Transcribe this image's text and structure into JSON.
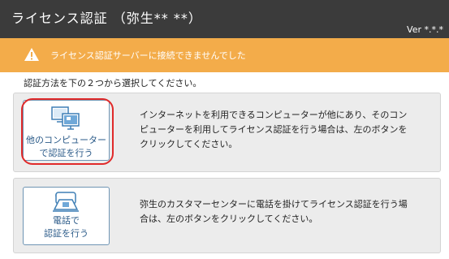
{
  "titlebar": {
    "title": "ライセンス認証 （弥生** **）",
    "version": "Ver *.*.*"
  },
  "warning": {
    "icon": "warning-icon",
    "text": "ライセンス認証サーバーに接続できませんでした",
    "color": "#f3ac4a"
  },
  "instruction": "認証方法を下の２つから選択してください。",
  "options": [
    {
      "icon": "computers-icon",
      "label_lines": [
        "他のコンピューター",
        "で認証を行う"
      ],
      "description_lines": [
        "インターネットを利用できるコンピューターが他にあり、そのコン",
        "ピューターを利用してライセンス認証を行う場合は、左のボタンを",
        "クリックしてください。"
      ]
    },
    {
      "icon": "phone-icon",
      "label_lines": [
        "電話で",
        "認証を行う"
      ],
      "description_lines": [
        "弥生のカスタマーセンターに電話を掛けてライセンス認証を行う場",
        "合は、左のボタンをクリックしてください。"
      ]
    }
  ],
  "colors": {
    "titlebar": "#3b3b3b",
    "button_text": "#2a5a88",
    "highlight": "#e02a2a"
  }
}
